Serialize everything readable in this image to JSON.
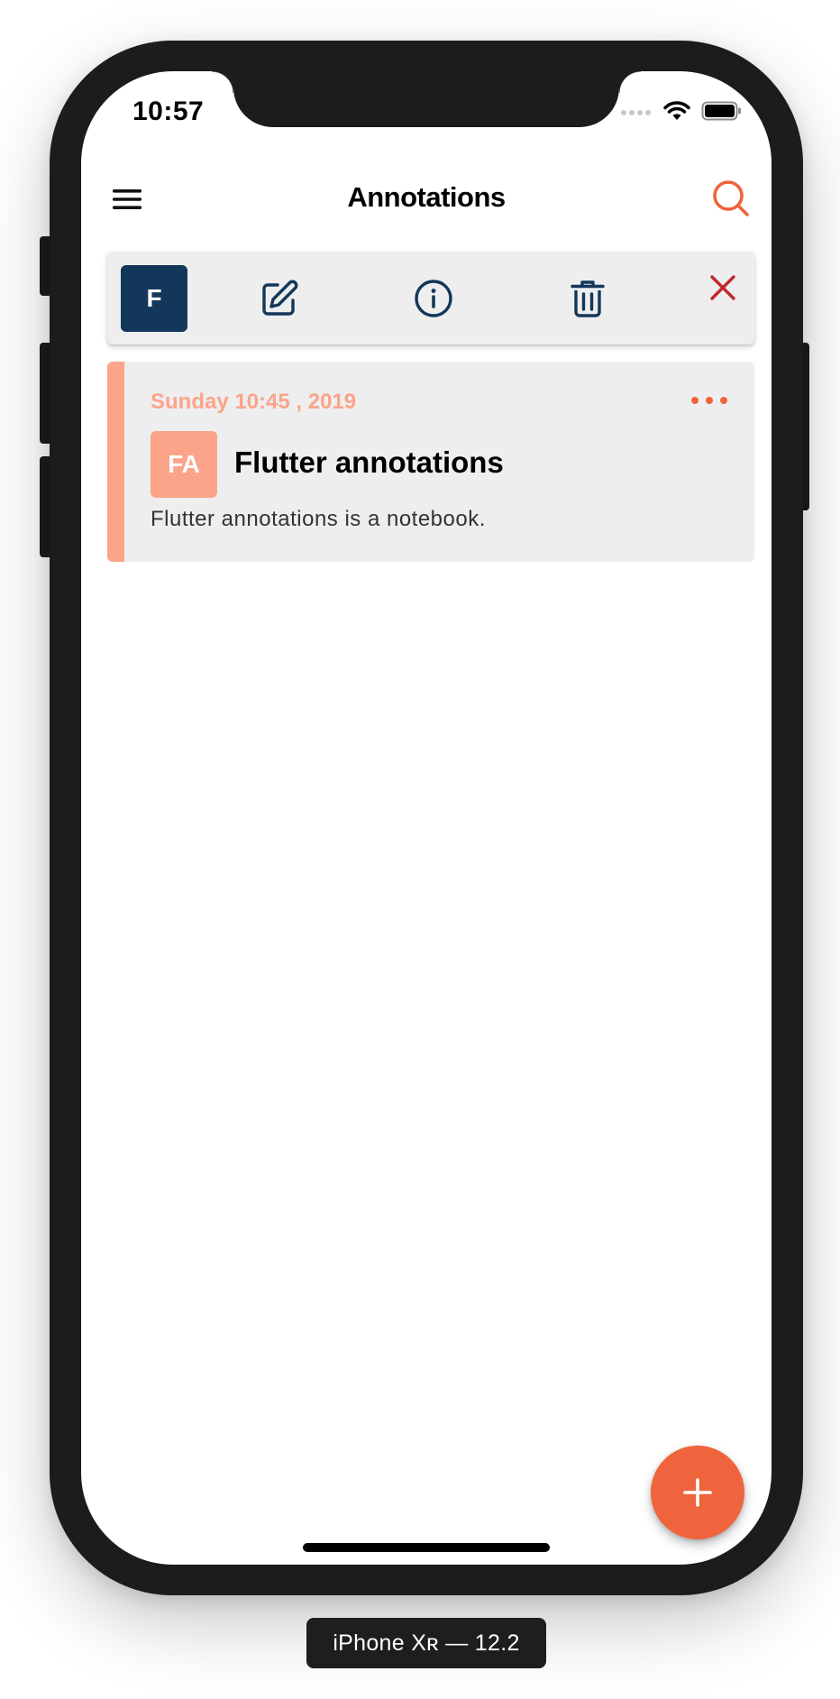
{
  "status_bar": {
    "time": "10:57"
  },
  "app_bar": {
    "title": "Annotations",
    "menu_icon": "hamburger-menu-icon",
    "search_icon": "search-icon"
  },
  "action_bar": {
    "notebook_badge": "F",
    "icons": [
      "edit-icon",
      "info-icon",
      "trash-icon",
      "close-icon"
    ]
  },
  "note": {
    "date": "Sunday 10:45 , 2019",
    "initials": "FA",
    "title": "Flutter annotations",
    "description": "Flutter annotations is a notebook."
  },
  "fab": {
    "icon": "add-icon"
  },
  "device_label": "iPhone Xʀ — 12.2",
  "colors": {
    "accent": "#ef643c",
    "note_accent": "#fba48a",
    "navy": "#12375a",
    "delete": "#c0282d",
    "card_bg": "#eeeeee"
  }
}
